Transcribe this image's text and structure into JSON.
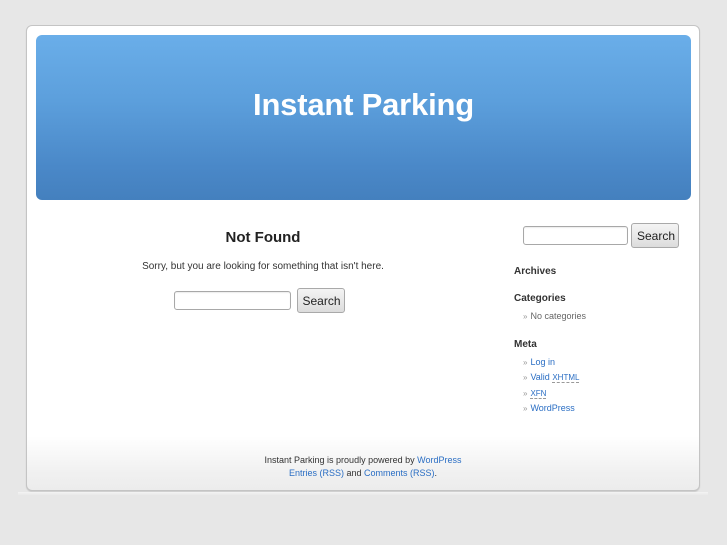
{
  "header": {
    "blog_title": "Instant Parking"
  },
  "main": {
    "heading": "Not Found",
    "message": "Sorry, but you are looking for something that isn't here.",
    "search": {
      "value": "",
      "placeholder": "",
      "button_label": "Search"
    }
  },
  "sidebar": {
    "search": {
      "value": "",
      "placeholder": "",
      "button_label": "Search"
    },
    "archives": {
      "title": "Archives"
    },
    "categories": {
      "title": "Categories",
      "items": [
        "No categories"
      ]
    },
    "meta": {
      "title": "Meta",
      "items": {
        "login": "Log in",
        "valid_prefix": "Valid",
        "xhtml": "XHTML",
        "xfn": "XFN",
        "wordpress": "WordPress"
      }
    },
    "bullet": "»"
  },
  "footer": {
    "line1_text": "Instant Parking is proudly powered by",
    "wordpress_link": "WordPress",
    "entries_rss": "Entries (RSS)",
    "and_text": "and",
    "comments_rss": "Comments (RSS)",
    "period": "."
  },
  "colors": {
    "header_top": "#6aaee9",
    "header_bottom": "#4480be",
    "link": "#2a6ec4",
    "background": "#e7e7e7"
  }
}
